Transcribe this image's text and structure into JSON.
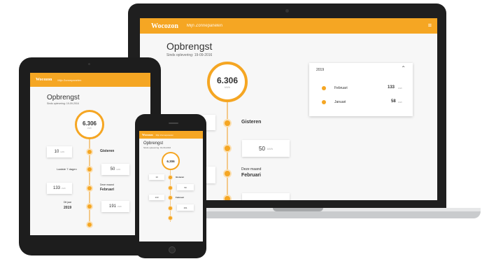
{
  "app": {
    "logo": "Wocozon",
    "menu_title": "Mijn Zonnepanelen"
  },
  "page": {
    "title": "Opbrengst",
    "subtitle": "Sinds oplevering: 19-09-2016"
  },
  "total": {
    "value": "6.306",
    "unit": "kWh"
  },
  "timeline": [
    {
      "label": "Gisteren",
      "value": "10",
      "unit": "kWh"
    },
    {
      "label": "Laatste 7 dagen",
      "value": "50",
      "unit": "kWh"
    },
    {
      "label": "Deze maand",
      "label2": "Februari",
      "value": "133",
      "unit": "kWh"
    },
    {
      "label": "Dit jaar",
      "label2": "2019",
      "value": "191",
      "unit": "kWh"
    }
  ],
  "year_panel": {
    "year": "2019",
    "months": [
      {
        "name": "Februari",
        "value": "133",
        "unit": "kWh"
      },
      {
        "name": "Januari",
        "value": "58",
        "unit": "kWh"
      }
    ]
  },
  "colors": {
    "accent": "#f5a623",
    "device_frame": "#1d1d1d",
    "screen_bg": "#f7f7f7"
  },
  "icons": {
    "menu": "hamburger-icon",
    "collapse": "chevron-up-icon"
  }
}
